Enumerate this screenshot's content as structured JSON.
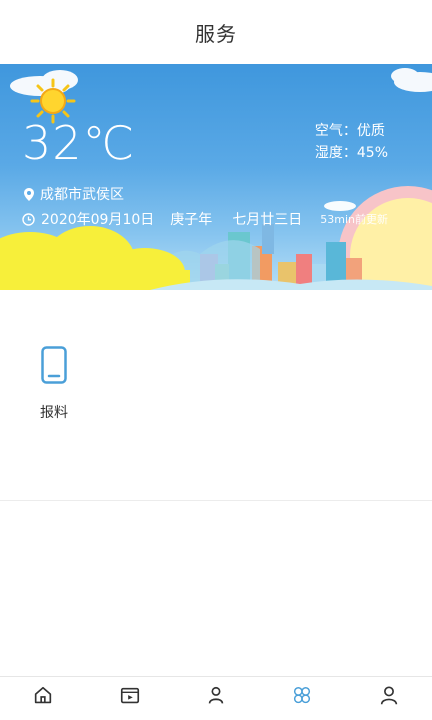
{
  "header": {
    "title": "服务"
  },
  "weather": {
    "temperature": "32℃",
    "air_quality": "空气：优质",
    "humidity": "湿度：45%",
    "location": "成都市武侯区",
    "date": "2020年09月10日",
    "lunar_year": "庚子年",
    "lunar_day": "七月廿三日",
    "updated": "53min前更新",
    "icons": [
      "sun-icon",
      "location-pin-icon",
      "clock-icon"
    ]
  },
  "services": [
    {
      "label": "报料",
      "icon": "phone-icon"
    }
  ],
  "tabbar": {
    "items": [
      {
        "label": "",
        "icon": "home-icon"
      },
      {
        "label": "",
        "icon": "video-icon"
      },
      {
        "label": "",
        "icon": "person-icon"
      },
      {
        "label": "",
        "icon": "service-icon",
        "active": true
      },
      {
        "label": "",
        "icon": "user-icon"
      }
    ],
    "active_color": "#4a9fd8"
  }
}
